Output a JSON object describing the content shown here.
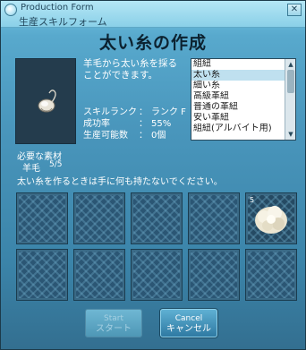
{
  "window": {
    "title_en": "Production Form",
    "title_jp": "生産スキルフォーム",
    "close_label": "✕"
  },
  "heading": "太い糸の作成",
  "description": [
    "羊毛から太い糸を採る",
    "ことができます。"
  ],
  "stats": {
    "rank": {
      "label": "スキルランク",
      "value": "ランク F"
    },
    "success": {
      "label": "成功率",
      "value": "55%"
    },
    "possible": {
      "label": "生産可能数",
      "value": "0個"
    }
  },
  "recipe_list": {
    "items": [
      "組紐",
      "太い糸",
      "細い糸",
      "高級革紐",
      "普通の革紐",
      "安い革紐",
      "組紐(アルバイト用)"
    ],
    "selected_index": 1
  },
  "materials": {
    "label": "必要な素材",
    "name": "羊毛",
    "count": "5/5"
  },
  "notice": "太い糸を作るときは手に何も持たないでください。",
  "inventory": {
    "slots": [
      {
        "row": 1,
        "count": ""
      },
      {
        "row": 1,
        "count": ""
      },
      {
        "row": 1,
        "count": ""
      },
      {
        "row": 1,
        "count": ""
      },
      {
        "row": 1,
        "count": "5",
        "item": "wool-bundle-icon"
      },
      {
        "row": 2,
        "count": ""
      },
      {
        "row": 2,
        "count": ""
      },
      {
        "row": 2,
        "count": ""
      },
      {
        "row": 2,
        "count": ""
      },
      {
        "row": 2,
        "count": ""
      }
    ]
  },
  "buttons": {
    "start_en": "Start",
    "start_jp": "スタート",
    "cancel_en": "Cancel",
    "cancel_jp": "キャンセル"
  },
  "colors": {
    "window_bg": "#4a97bd",
    "listbox_selected": "#bfe0ef",
    "heading_text": "#0c2230"
  }
}
